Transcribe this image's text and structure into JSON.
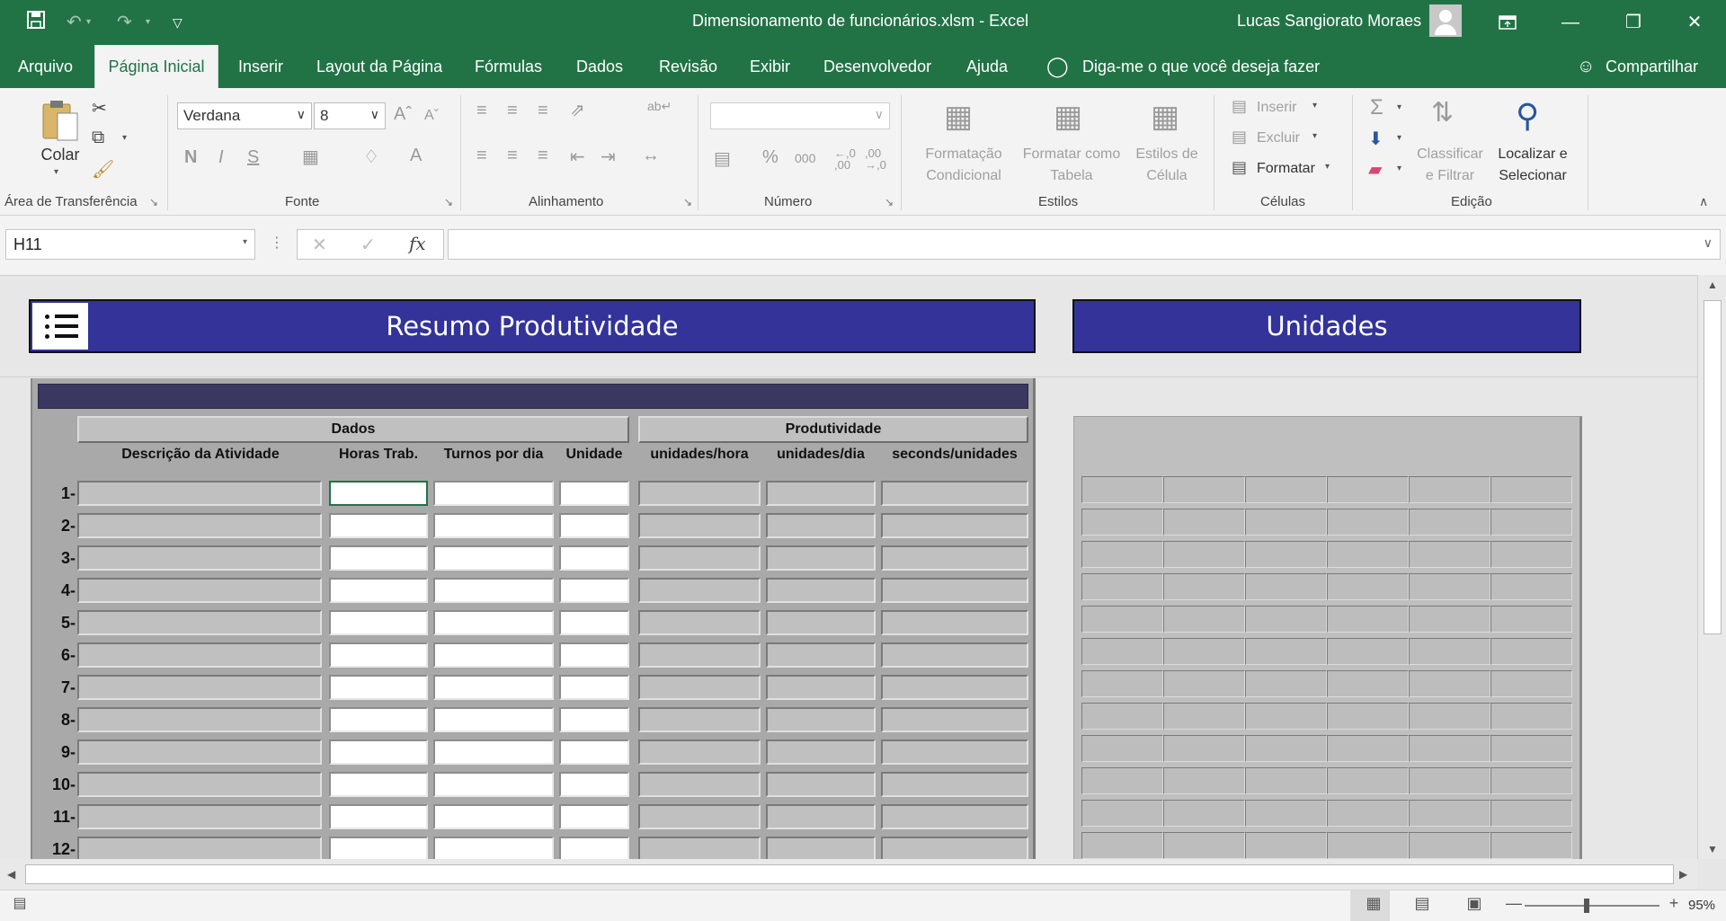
{
  "window": {
    "title": "Dimensionamento de funcionários.xlsm  -  Excel",
    "user": "Lucas Sangiorato Moraes"
  },
  "ribbon_tabs": [
    "Arquivo",
    "Página Inicial",
    "Inserir",
    "Layout da Página",
    "Fórmulas",
    "Dados",
    "Revisão",
    "Exibir",
    "Desenvolvedor",
    "Ajuda"
  ],
  "tell_me": "Diga-me o que você deseja fazer",
  "share": "Compartilhar",
  "ribbon": {
    "clipboard": {
      "paste": "Colar",
      "label": "Área de Transferência"
    },
    "font": {
      "name": "Verdana",
      "size": "8",
      "bold": "N",
      "italic": "I",
      "underline": "S",
      "label": "Fonte"
    },
    "alignment": {
      "label": "Alinhamento"
    },
    "number": {
      "format": "",
      "percent": "%",
      "thousands": "000",
      "label": "Número"
    },
    "styles": {
      "conditional": "Formatação Condicional",
      "as_table": "Formatar como Tabela",
      "cell_styles": "Estilos de Célula",
      "label": "Estilos"
    },
    "cells": {
      "insert": "Inserir",
      "delete": "Excluir",
      "format": "Formatar",
      "label": "Células"
    },
    "editing": {
      "sort": "Classificar e Filtrar",
      "find": "Localizar e Selecionar",
      "label": "Edição"
    }
  },
  "formula_bar": {
    "name_box": "H11",
    "formula": ""
  },
  "sheet": {
    "title_left": "Resumo Produtividade",
    "title_right": "Unidades",
    "group_dados": "Dados",
    "group_produtividade": "Produtividade",
    "columns": [
      "Descrição da Atividade",
      "Horas Trab.",
      "Turnos por dia",
      "Unidade",
      "unidades/hora",
      "unidades/dia",
      "seconds/unidades"
    ],
    "rows": [
      "1-",
      "2-",
      "3-",
      "4-",
      "5-",
      "6-",
      "7-",
      "8-",
      "9-",
      "10-",
      "11-",
      "12-"
    ]
  },
  "status": {
    "zoom": "95%"
  },
  "colors": {
    "excel_green": "#217346",
    "header_blue": "#333399",
    "panel_gray": "#a9a9a9"
  }
}
